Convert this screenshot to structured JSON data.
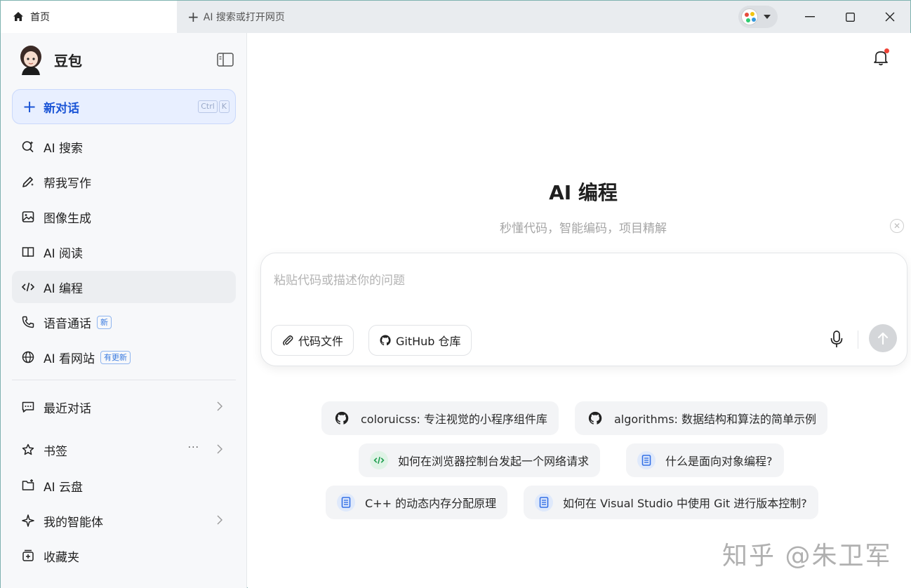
{
  "titlebar": {
    "home_tab": "首页",
    "new_tab_placeholder": "AI 搜索或打开网页"
  },
  "sidebar": {
    "brand_name": "豆包",
    "new_chat": {
      "label": "新对话",
      "kbd": [
        "Ctrl",
        "K"
      ]
    },
    "items": [
      {
        "label": "AI 搜索"
      },
      {
        "label": "帮我写作"
      },
      {
        "label": "图像生成"
      },
      {
        "label": "AI 阅读"
      },
      {
        "label": "AI 编程",
        "active": true
      },
      {
        "label": "语音通话",
        "badge": "新"
      },
      {
        "label": "AI 看网站",
        "badge": "有更新"
      }
    ],
    "secondary": [
      {
        "label": "最近对话"
      },
      {
        "label": "书签",
        "more": "···"
      },
      {
        "label": "AI 云盘"
      },
      {
        "label": "我的智能体"
      },
      {
        "label": "收藏夹"
      }
    ]
  },
  "main": {
    "title": "AI 编程",
    "subtitle": "秒懂代码，智能编码，项目精解",
    "input_placeholder": "粘贴代码或描述你的问题",
    "buttons": {
      "code_file": "代码文件",
      "github_repo": "GitHub 仓库"
    },
    "suggestions": [
      {
        "text": "coloruicss: 专注视觉的小程序组件库",
        "icon": "github-icon"
      },
      {
        "text": "algorithms: 数据结构和算法的简单示例",
        "icon": "github-icon"
      },
      {
        "text": "如何在浏览器控制台发起一个网络请求",
        "icon": "code-icon"
      },
      {
        "text": "什么是面向对象编程?",
        "icon": "document-icon"
      },
      {
        "text": "C++ 的动态内存分配原理",
        "icon": "document-icon"
      },
      {
        "text": "如何在 Visual Studio 中使用 Git 进行版本控制?",
        "icon": "document-icon"
      }
    ]
  },
  "watermark": "知乎 @朱卫军",
  "colors": {
    "accent": "#1b55d6",
    "new_chat_bg": "#e8efff",
    "sidebar_bg": "#f7f8fa",
    "notification_dot": "#f04438"
  }
}
